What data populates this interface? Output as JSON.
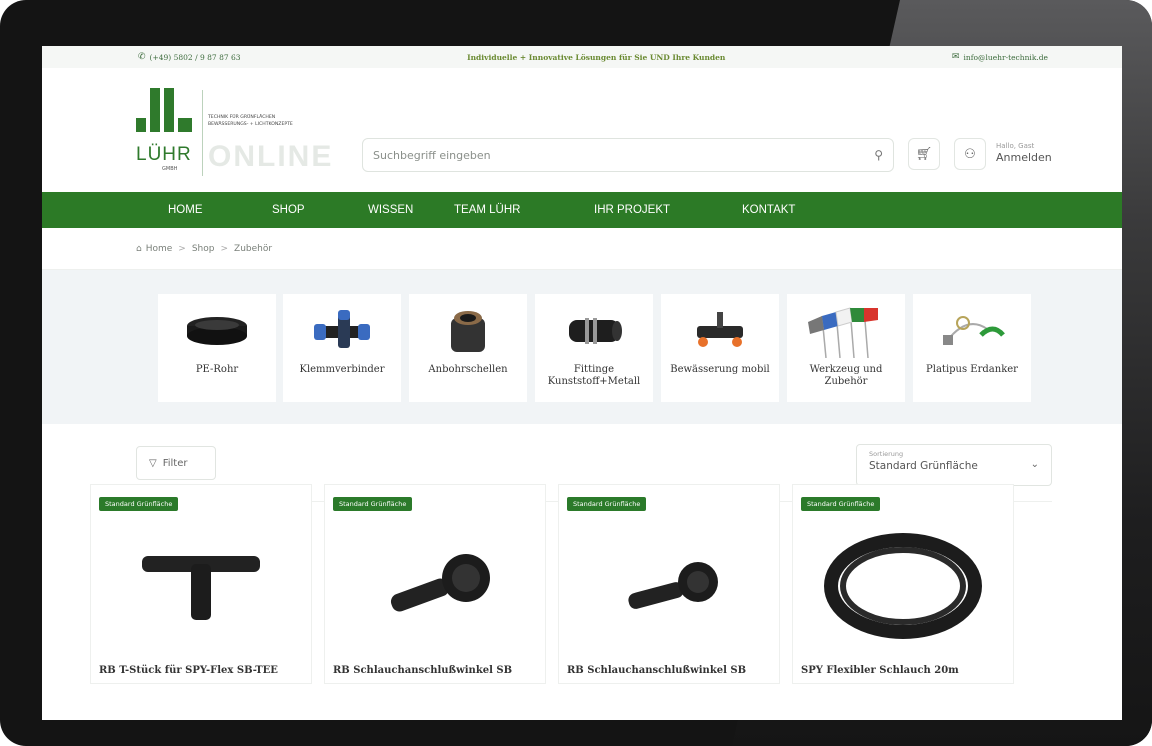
{
  "topbar": {
    "phone": "(+49) 5802 / 9 87 87 63",
    "tagline": "Individuelle + Innovative Lösungen für Sie UND Ihre Kunden",
    "email": "info@luehr-technik.de"
  },
  "logo": {
    "wordmark": "LÜHR",
    "gmbh": "GMBH",
    "tagline_1": "TECHNIK FÜR GRÜNFLÄCHEN",
    "tagline_2": "BEWÄSSERUNGS- + LICHTKONZEPTE",
    "online": "ONLINE"
  },
  "search": {
    "placeholder": "Suchbegriff eingeben"
  },
  "account": {
    "greeting": "Hallo, Gast",
    "login": "Anmelden"
  },
  "nav": {
    "items": [
      "HOME",
      "SHOP",
      "WISSEN",
      "TEAM LÜHR",
      "IHR PROJEKT",
      "KONTAKT"
    ]
  },
  "breadcrumb": {
    "items": [
      "Home",
      "Shop",
      "Zubehör"
    ]
  },
  "categories": [
    {
      "label": "PE-Rohr"
    },
    {
      "label": "Klemmverbinder"
    },
    {
      "label": "Anbohrschellen"
    },
    {
      "label": "Fittinge Kunststoff+Metall"
    },
    {
      "label": "Bewässerung mobil"
    },
    {
      "label": "Werkzeug und Zubehör"
    },
    {
      "label": "Platipus Erdanker"
    }
  ],
  "filter": {
    "label": "Filter"
  },
  "sort": {
    "label": "Sortierung",
    "value": "Standard Grünfläche"
  },
  "products": [
    {
      "badge": "Standard Grünfläche",
      "title": "RB T-Stück für SPY-Flex SB-TEE"
    },
    {
      "badge": "Standard Grünfläche",
      "title": "RB Schlauchanschlußwinkel SB"
    },
    {
      "badge": "Standard Grünfläche",
      "title": "RB Schlauchanschlußwinkel SB"
    },
    {
      "badge": "Standard Grünfläche",
      "title": "SPY Flexibler Schlauch 20m"
    }
  ],
  "colors": {
    "brand_green": "#2c7a26",
    "badge_green": "#2b7a2a"
  },
  "icons": [
    "phone-icon",
    "mail-icon",
    "search-icon",
    "cart-icon",
    "user-icon",
    "home-icon",
    "filter-icon",
    "chevron-down-icon"
  ]
}
